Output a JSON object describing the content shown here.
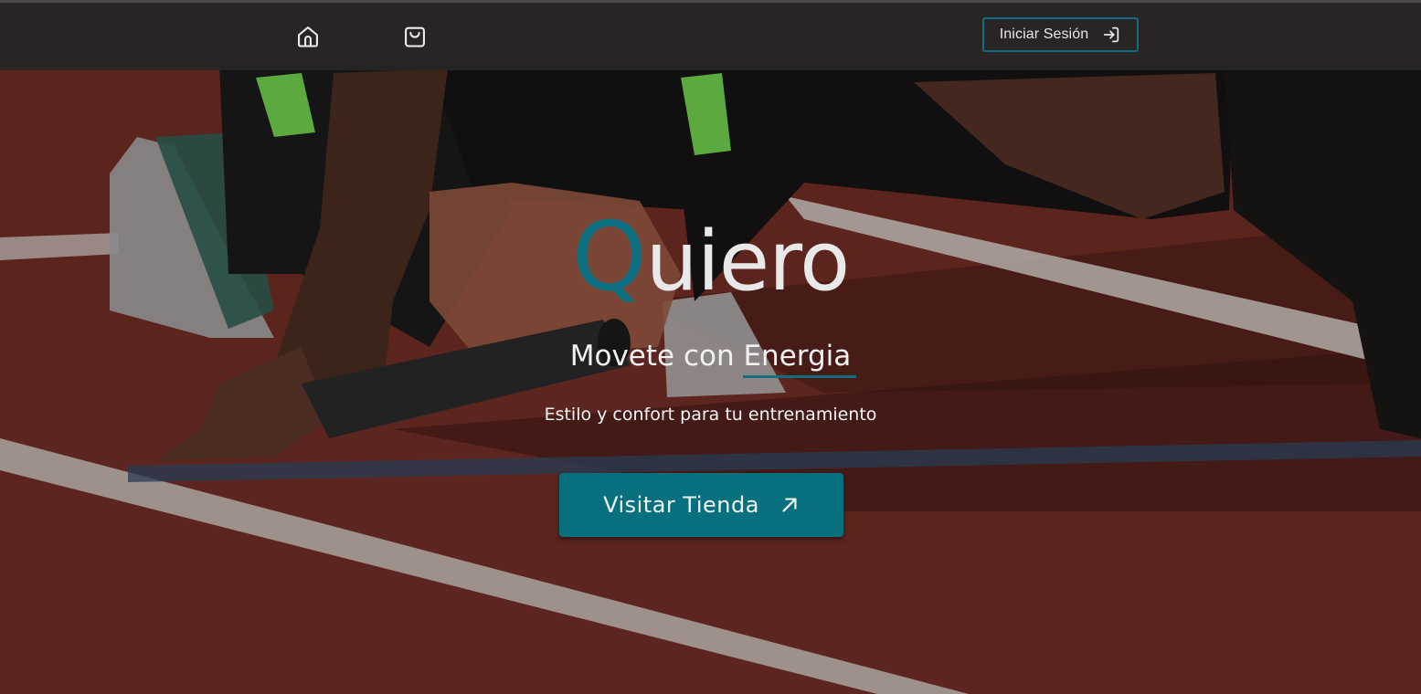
{
  "nav": {
    "home_icon": "home-icon",
    "cart_icon": "shopping-bag-icon",
    "login_label": "Iniciar Sesión",
    "login_icon": "login-arrow-icon"
  },
  "hero": {
    "brand_first": "Q",
    "brand_rest": "uiero",
    "tagline_prefix": "Movete con ",
    "tagline_accent": "Energia",
    "subtitle": "Estilo y confort para tu entrenamiento",
    "cta_label": "Visitar Tienda",
    "cta_icon": "arrow-up-right-icon"
  },
  "colors": {
    "accent": "#0e6f80",
    "navbar": "#262626",
    "text": "#e9e9e9"
  }
}
